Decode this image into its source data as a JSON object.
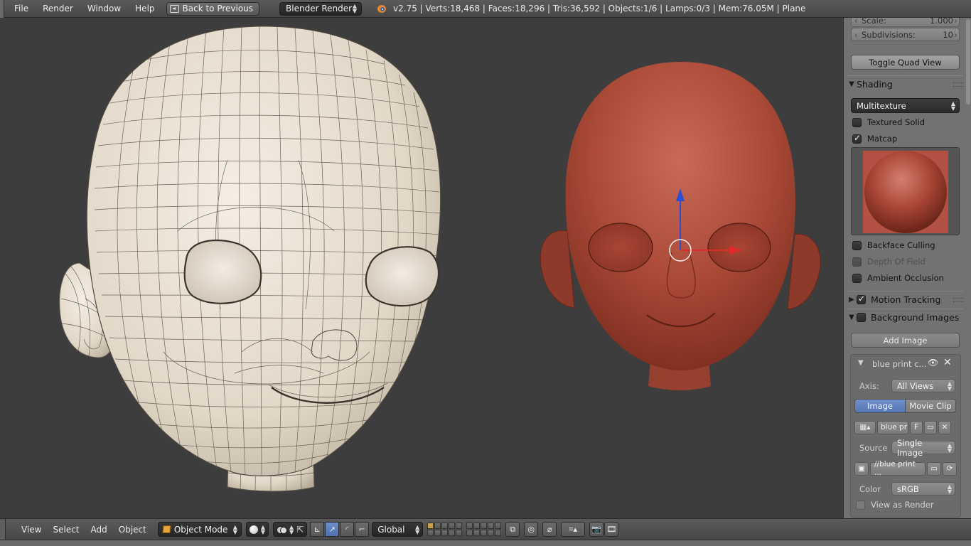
{
  "top_header": {
    "menus": [
      "File",
      "Render",
      "Window",
      "Help"
    ],
    "back_button": "Back to Previous",
    "render_engine": "Blender Render",
    "stats": "v2.75 | Verts:18,468 | Faces:18,296 | Tris:36,592 | Objects:1/6 | Lamps:0/3 | Mem:76.05M | Plane"
  },
  "side_panel": {
    "scale_label": "Scale:",
    "scale_value": "1.000",
    "subdivisions_label": "Subdivisions:",
    "subdivisions_value": "10",
    "toggle_quad_view": "Toggle Quad View",
    "shading": {
      "title": "Shading",
      "mode": "Multitexture",
      "textured_solid": "Textured Solid",
      "matcap": "Matcap",
      "backface_culling": "Backface Culling",
      "depth_of_field": "Depth Of Field",
      "ambient_occlusion": "Ambient Occlusion"
    },
    "motion_tracking": "Motion Tracking",
    "background_images": {
      "title": "Background Images",
      "add_image": "Add Image",
      "item_name": "blue print c...",
      "axis_label": "Axis:",
      "axis_value": "All Views",
      "tab_image": "Image",
      "tab_movie_clip": "Movie Clip",
      "image_name": "blue pr",
      "fake_user": "F",
      "source_label": "Source",
      "source_value": "Single Image",
      "filepath": "//blue print ...",
      "color_label": "Color",
      "color_value": "sRGB",
      "view_as_render": "View as Render"
    }
  },
  "bottom_header": {
    "menus": [
      "View",
      "Select",
      "Add",
      "Object"
    ],
    "mode": "Object Mode",
    "orientation": "Global"
  },
  "colors": {
    "viewport_bg": "#3d3d3d",
    "panel_bg": "#727272",
    "accent_blue": "#5677b5",
    "clay_red": "#a84a38",
    "wire_head": "#e9e1d4"
  }
}
